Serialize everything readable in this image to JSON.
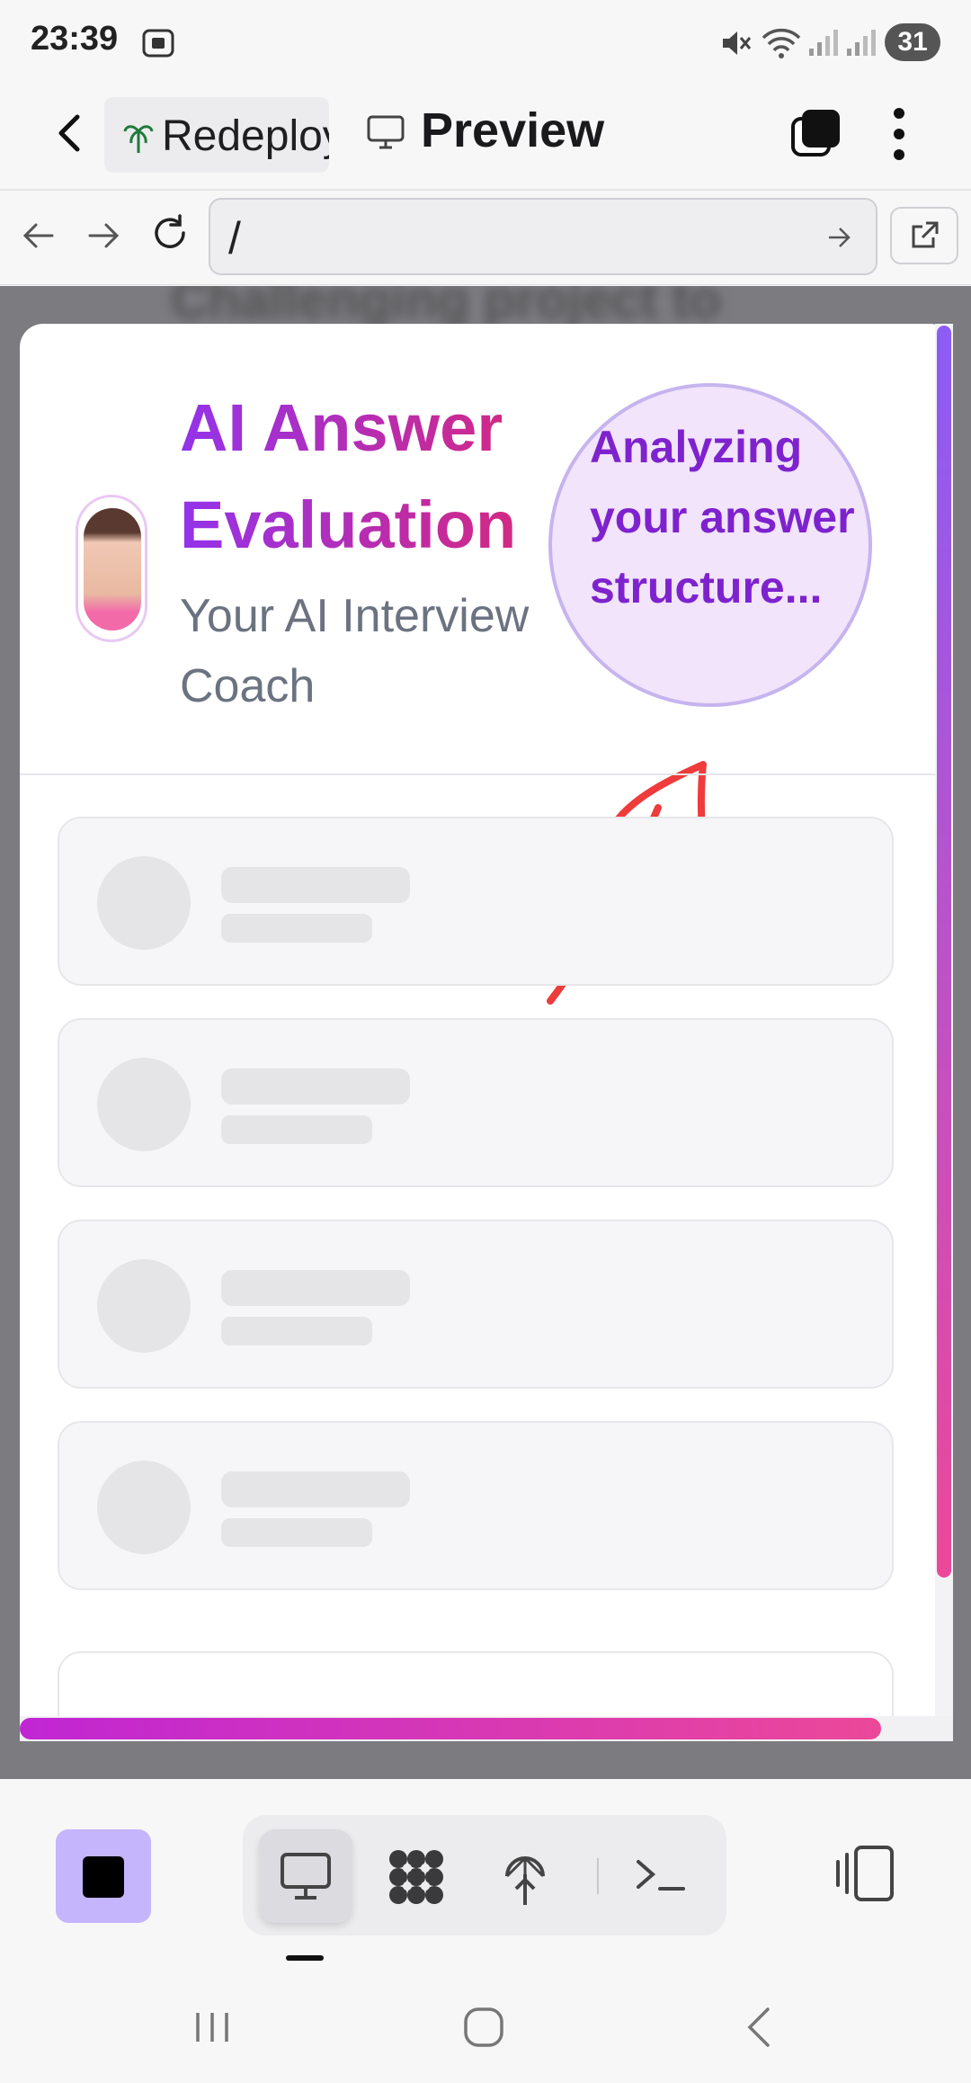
{
  "status_bar": {
    "time": "23:39",
    "battery": "31"
  },
  "header": {
    "project_name": "Redeploy",
    "title": "Preview"
  },
  "url_bar": {
    "path": "/"
  },
  "background_text": "Challenging project to",
  "modal": {
    "title": "AI Answer Evaluation",
    "subtitle": "Your AI Interview Coach",
    "status_bubble": "Analyzing your answer structure...",
    "skeleton_cards": 4
  },
  "colors": {
    "accent_purple": "#9333ea",
    "accent_pink": "#db2777",
    "stop_button": "#c4b5fd"
  },
  "icons": {
    "back": "chevron-left-icon",
    "project": "palm-tree-icon",
    "preview": "monitor-icon",
    "tabs": "tabs-icon",
    "menu": "more-vertical-icon",
    "nav_back": "arrow-left-icon",
    "nav_forward": "arrow-right-icon",
    "reload": "reload-icon",
    "go": "arrow-right-icon",
    "external": "external-link-icon",
    "stop": "stop-icon",
    "desktop": "monitor-icon",
    "plugins": "puzzle-icon",
    "deploy": "antenna-icon",
    "terminal": "terminal-icon",
    "layout": "panel-layout-icon"
  }
}
